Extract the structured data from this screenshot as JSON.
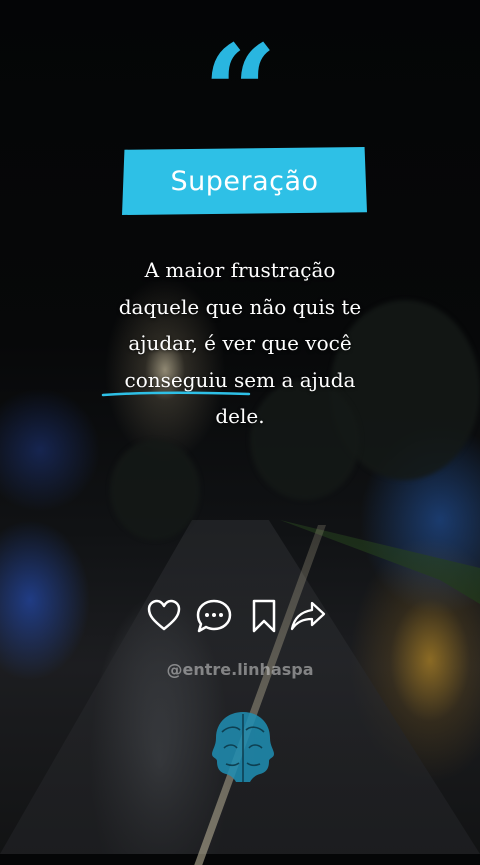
{
  "post": {
    "quote_symbol": "“",
    "title": "Superação",
    "quote_lines": [
      "A maior frustração",
      "daquele que não quis te",
      "ajudar, é ver que você",
      "conseguiu sem a ajuda",
      "dele."
    ],
    "handle": "@entre.linhaspa"
  },
  "actions": [
    {
      "name": "like",
      "icon": "heart-icon"
    },
    {
      "name": "comment",
      "icon": "speech-bubble-icon"
    },
    {
      "name": "save",
      "icon": "bookmark-icon"
    },
    {
      "name": "share",
      "icon": "share-arrow-icon"
    }
  ],
  "colors": {
    "accent": "#2ec0e6",
    "quote_mark": "#29b6e0",
    "text": "#ffffff",
    "background": "#050607"
  }
}
